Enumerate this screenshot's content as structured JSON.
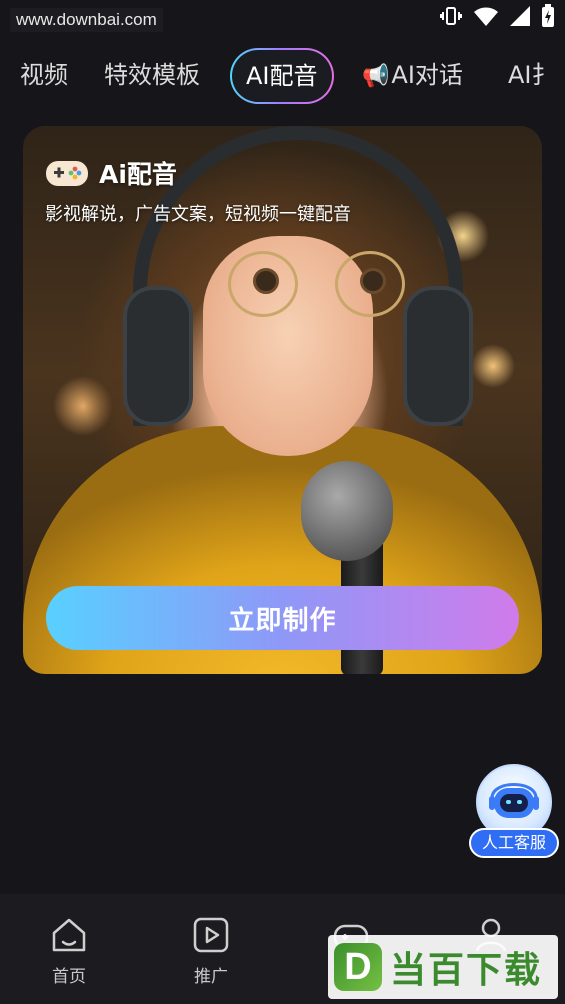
{
  "status_bar": {
    "watermark_url": "www.downbai.com",
    "icons": [
      "vibrate-icon",
      "wifi-icon",
      "signal-icon",
      "battery-icon"
    ]
  },
  "tabs": [
    {
      "label": "视频",
      "partial": true
    },
    {
      "label": "特效模板"
    },
    {
      "label": "AI配音",
      "active": true
    },
    {
      "label": "AI对话",
      "icon": "megaphone-icon"
    },
    {
      "label": "AI扌",
      "partial": true
    }
  ],
  "hero": {
    "title": "Ai配音",
    "title_icon": "gamepad-icon",
    "subtitle": "影视解说，广告文案，短视频一键配音",
    "cta_label": "立即制作"
  },
  "customer_service": {
    "label": "人工客服",
    "icon": "robot-icon"
  },
  "bottom_nav": [
    {
      "label": "首页",
      "icon": "home-icon"
    },
    {
      "label": "推广",
      "icon": "play-icon"
    },
    {
      "label": "",
      "icon": "gamepad-icon"
    },
    {
      "label": "",
      "icon": "user-icon"
    }
  ],
  "brand_watermark": {
    "logo": "D",
    "text": "当百下载"
  },
  "colors": {
    "background": "#16161a",
    "nav_background": "#1c1c20",
    "cta_gradient_start": "#58d0ff",
    "cta_gradient_end": "#d07bea",
    "service_blue": "#2f6df5"
  }
}
